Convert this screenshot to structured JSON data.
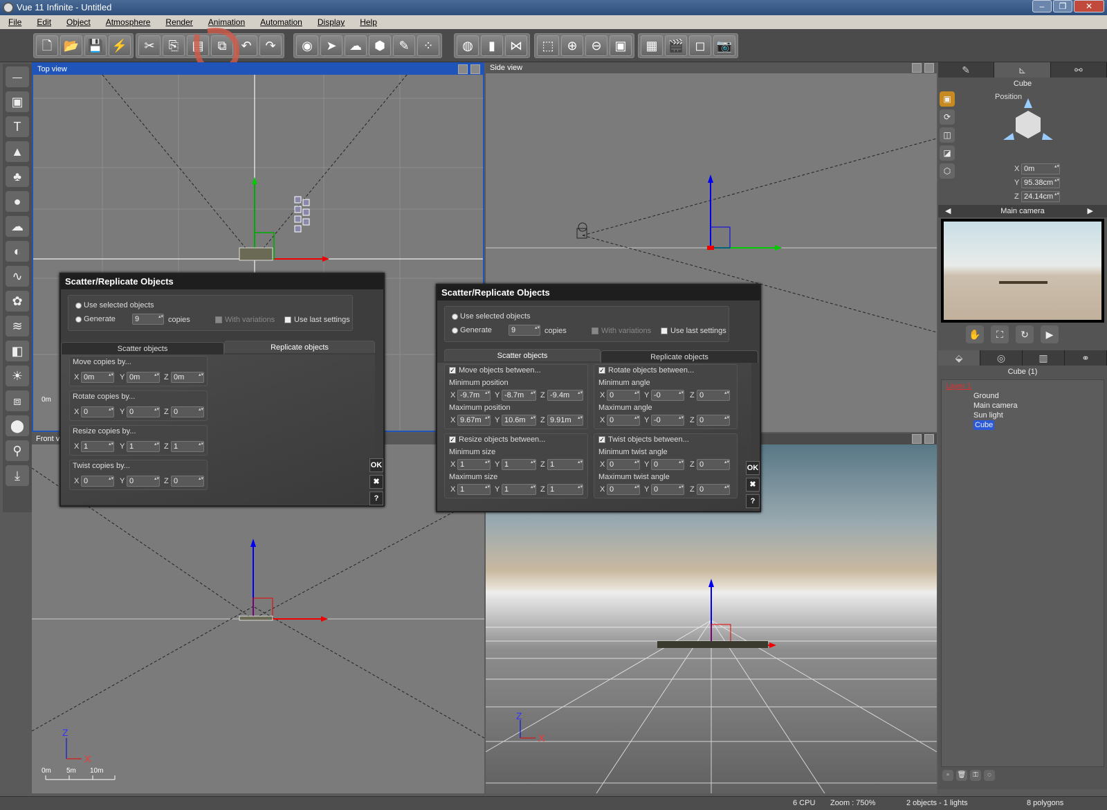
{
  "window": {
    "title": "Vue 11 Infinite - Untitled",
    "controls": [
      "–",
      "❐",
      "✕"
    ]
  },
  "menu": [
    "File",
    "Edit",
    "Object",
    "Atmosphere",
    "Render",
    "Animation",
    "Automation",
    "Display",
    "Help"
  ],
  "viewports": {
    "top": {
      "title": "Top view",
      "scale_left": "0m"
    },
    "side": {
      "title": "Side view"
    },
    "front": {
      "title": "Front view",
      "scale": [
        "0m",
        "5m",
        "10m"
      ],
      "axes": [
        "Z",
        "X"
      ]
    },
    "persp": {
      "axes": [
        "Z",
        "X"
      ]
    }
  },
  "dialog1": {
    "title": "Scatter/Replicate Objects",
    "use_selected": "Use selected objects",
    "generate": "Generate",
    "copies_value": "9",
    "copies": "copies",
    "with_variations": "With variations",
    "use_last": "Use last settings",
    "tab_scatter": "Scatter objects",
    "tab_replicate": "Replicate objects",
    "move_label": "Move copies by...",
    "move": {
      "x": "0m",
      "y": "0m",
      "z": "0m"
    },
    "rotate_label": "Rotate copies by...",
    "rotate": {
      "x": "0",
      "y": "0",
      "z": "0"
    },
    "resize_label": "Resize copies by...",
    "resize": {
      "x": "1",
      "y": "1",
      "z": "1"
    },
    "twist_label": "Twist copies by...",
    "twist": {
      "x": "0",
      "y": "0",
      "z": "0"
    },
    "ok": "OK",
    "cancel": "✖",
    "help": "?"
  },
  "dialog2": {
    "title": "Scatter/Replicate Objects",
    "use_selected": "Use selected objects",
    "generate": "Generate",
    "copies_value": "9",
    "copies": "copies",
    "with_variations": "With variations",
    "use_last": "Use last settings",
    "tab_scatter": "Scatter objects",
    "tab_replicate": "Replicate objects",
    "move_label": "Move objects between...",
    "min_pos_label": "Minimum position",
    "min_pos": {
      "x": "-9.7m",
      "y": "-8.7m",
      "z": "-9.4m"
    },
    "max_pos_label": "Maximum position",
    "max_pos": {
      "x": "9.67m",
      "y": "10.6m",
      "z": "9.91m"
    },
    "rotate_label": "Rotate objects between...",
    "min_angle_label": "Minimum angle",
    "min_angle": {
      "x": "0",
      "y": "-0",
      "z": "0"
    },
    "max_angle_label": "Maximum angle",
    "max_angle": {
      "x": "0",
      "y": "-0",
      "z": "0"
    },
    "resize_label": "Resize objects between...",
    "min_size_label": "Minimum size",
    "min_size": {
      "x": "1",
      "y": "1",
      "z": "1"
    },
    "max_size_label": "Maximum size",
    "max_size": {
      "x": "1",
      "y": "1",
      "z": "1"
    },
    "twist_label": "Twist objects between...",
    "min_twist_label": "Minimum twist angle",
    "min_twist": {
      "x": "0",
      "y": "0",
      "z": "0"
    },
    "max_twist_label": "Maximum twist angle",
    "max_twist": {
      "x": "0",
      "y": "0",
      "z": "0"
    },
    "ok": "OK",
    "cancel": "✖",
    "help": "?"
  },
  "right": {
    "object_name": "Cube",
    "position_label": "Position",
    "pos": {
      "x": "0m",
      "y": "95.38cm",
      "z": "24.14cm"
    },
    "camera": "Main camera",
    "list_header": "Cube (1)",
    "tree": [
      "Layer 1",
      "Ground",
      "Main camera",
      "Sun light",
      "Cube"
    ]
  },
  "status": {
    "cpu": "6 CPU",
    "zoom": "Zoom : 750%",
    "objects": "2 objects - 1 lights",
    "polygons": "8 polygons"
  },
  "axis_letters": {
    "x": "X",
    "y": "Y",
    "z": "Z"
  }
}
